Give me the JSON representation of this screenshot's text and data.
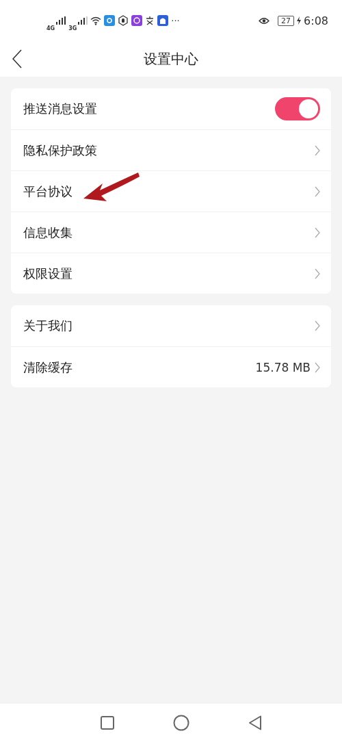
{
  "status_bar": {
    "signal_1": "4G",
    "signal_2": "3G",
    "more": "···",
    "battery": "27",
    "time": "6:08"
  },
  "header": {
    "title": "设置中心"
  },
  "groups": [
    {
      "items": [
        {
          "kind": "toggle",
          "label": "推送消息设置",
          "on": true
        },
        {
          "kind": "link",
          "label": "隐私保护政策"
        },
        {
          "kind": "link",
          "label": "平台协议"
        },
        {
          "kind": "link",
          "label": "信息收集"
        },
        {
          "kind": "link",
          "label": "权限设置"
        }
      ]
    },
    {
      "items": [
        {
          "kind": "link",
          "label": "关于我们"
        },
        {
          "kind": "link",
          "label": "清除缓存",
          "value": "15.78 MB"
        }
      ]
    }
  ]
}
